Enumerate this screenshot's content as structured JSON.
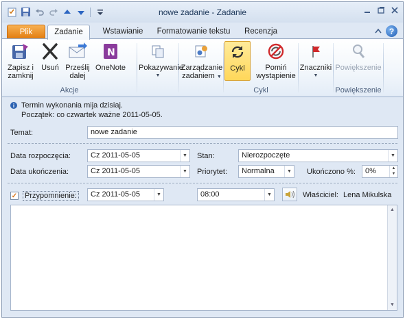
{
  "window": {
    "title": "nowe zadanie - Zadanie",
    "controls": [
      "minimize-icon",
      "restore-icon",
      "close-icon"
    ]
  },
  "qat": [
    "task-icon",
    "save-icon",
    "undo-icon",
    "redo-icon",
    "up-icon",
    "down-icon",
    "customize-icon"
  ],
  "tabs": {
    "file": "Plik",
    "items": [
      "Zadanie",
      "Wstawianie",
      "Formatowanie tekstu",
      "Recenzja"
    ],
    "active": "Zadanie"
  },
  "ribbon": {
    "akcje": {
      "label": "Akcje",
      "save_close": [
        "Zapisz i",
        "zamknij"
      ],
      "delete": "Usuń",
      "forward": [
        "Prześlij",
        "dalej"
      ],
      "onenote": "OneNote"
    },
    "show": {
      "label": "Pokazywanie"
    },
    "manage": {
      "label": [
        "Zarządzanie",
        "zadaniem"
      ]
    },
    "cykl": {
      "label": "Cykl",
      "recurrence": "Cykl",
      "skip": [
        "Pomiń",
        "wystąpienie"
      ]
    },
    "tags": {
      "label": "Znaczniki"
    },
    "zoom": {
      "label": "Powiększenie",
      "button": "Powiększenie"
    }
  },
  "info": {
    "line1": "Termin wykonania mija dzisiaj.",
    "line2": "Początek: co czwartek ważne 2011-05-05."
  },
  "form": {
    "subject_label": "Temat:",
    "subject_value": "nowe zadanie",
    "start_label": "Data rozpoczęcia:",
    "start_value": "Cz 2011-05-05",
    "due_label": "Data ukończenia:",
    "due_value": "Cz 2011-05-05",
    "status_label": "Stan:",
    "status_value": "Nierozpoczęte",
    "priority_label": "Priorytet:",
    "priority_value": "Normalna",
    "percent_label": "Ukończono %:",
    "percent_value": "0%",
    "reminder_label": "Przypomnienie:",
    "reminder_checked": true,
    "reminder_date": "Cz 2011-05-05",
    "reminder_time": "08:00",
    "owner_label": "Właściciel:",
    "owner_value": "Lena Mikulska"
  }
}
